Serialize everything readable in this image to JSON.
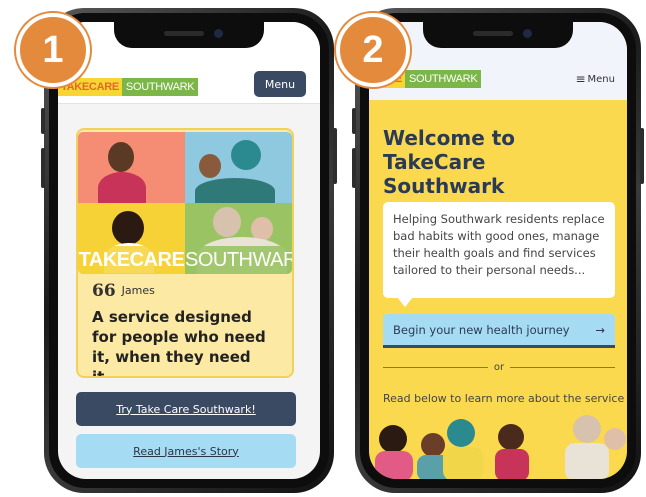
{
  "badges": {
    "first": "1",
    "second": "2"
  },
  "phone1": {
    "logo": {
      "take": "TAKECARE",
      "south": "SOUTHWARK"
    },
    "menu_label": "Menu",
    "card": {
      "banner_take": "TAKECARE",
      "banner_south": "SOUTHWARK",
      "quote_mark": "66",
      "author": "James",
      "quote": "A service designed for people who need it, when they need it..."
    },
    "try_button": "Try Take Care Southwark!",
    "read_button": "Read James's Story"
  },
  "phone2": {
    "logo": {
      "take": "CARE",
      "south": "SOUTHWARK"
    },
    "menu_label": "Menu",
    "title": "Welcome to TakeCare Southwark",
    "intro": "Helping Southwark residents replace bad habits with good ones, manage their health goals and find services tailored to their personal needs...",
    "journey_button": "Begin your new health journey",
    "journey_arrow": "→",
    "or_label": "or",
    "learn_text": "Read below to learn more about the service"
  },
  "colors": {
    "brand_navy": "#3a4a63",
    "brand_yellow": "#fbd94f",
    "brand_light_blue": "#a6dcf3",
    "brand_green": "#7ab648",
    "badge_orange": "#e48a3d"
  }
}
